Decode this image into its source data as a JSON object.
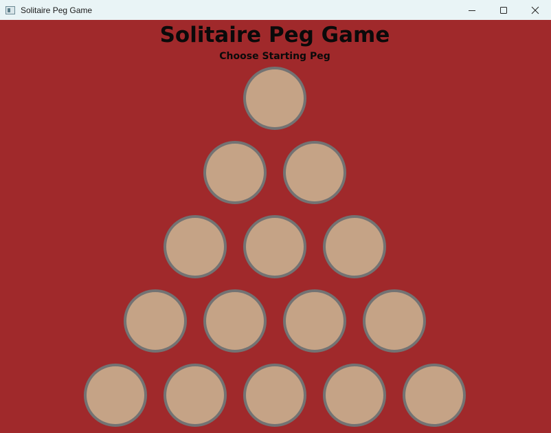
{
  "window": {
    "title": "Solitaire Peg Game",
    "controls": [
      "minimize",
      "maximize",
      "close"
    ]
  },
  "game": {
    "title": "Solitaire Peg Game",
    "subtitle": "Choose Starting Peg"
  },
  "board": {
    "rows": [
      1,
      2,
      3,
      4,
      5
    ],
    "peg_fill": "#c5a386",
    "peg_border": "#737373",
    "background": "#a0292b"
  },
  "icons": {
    "app": "app-window-icon",
    "minimize": "minimize-icon",
    "maximize": "maximize-icon",
    "close": "close-icon"
  }
}
